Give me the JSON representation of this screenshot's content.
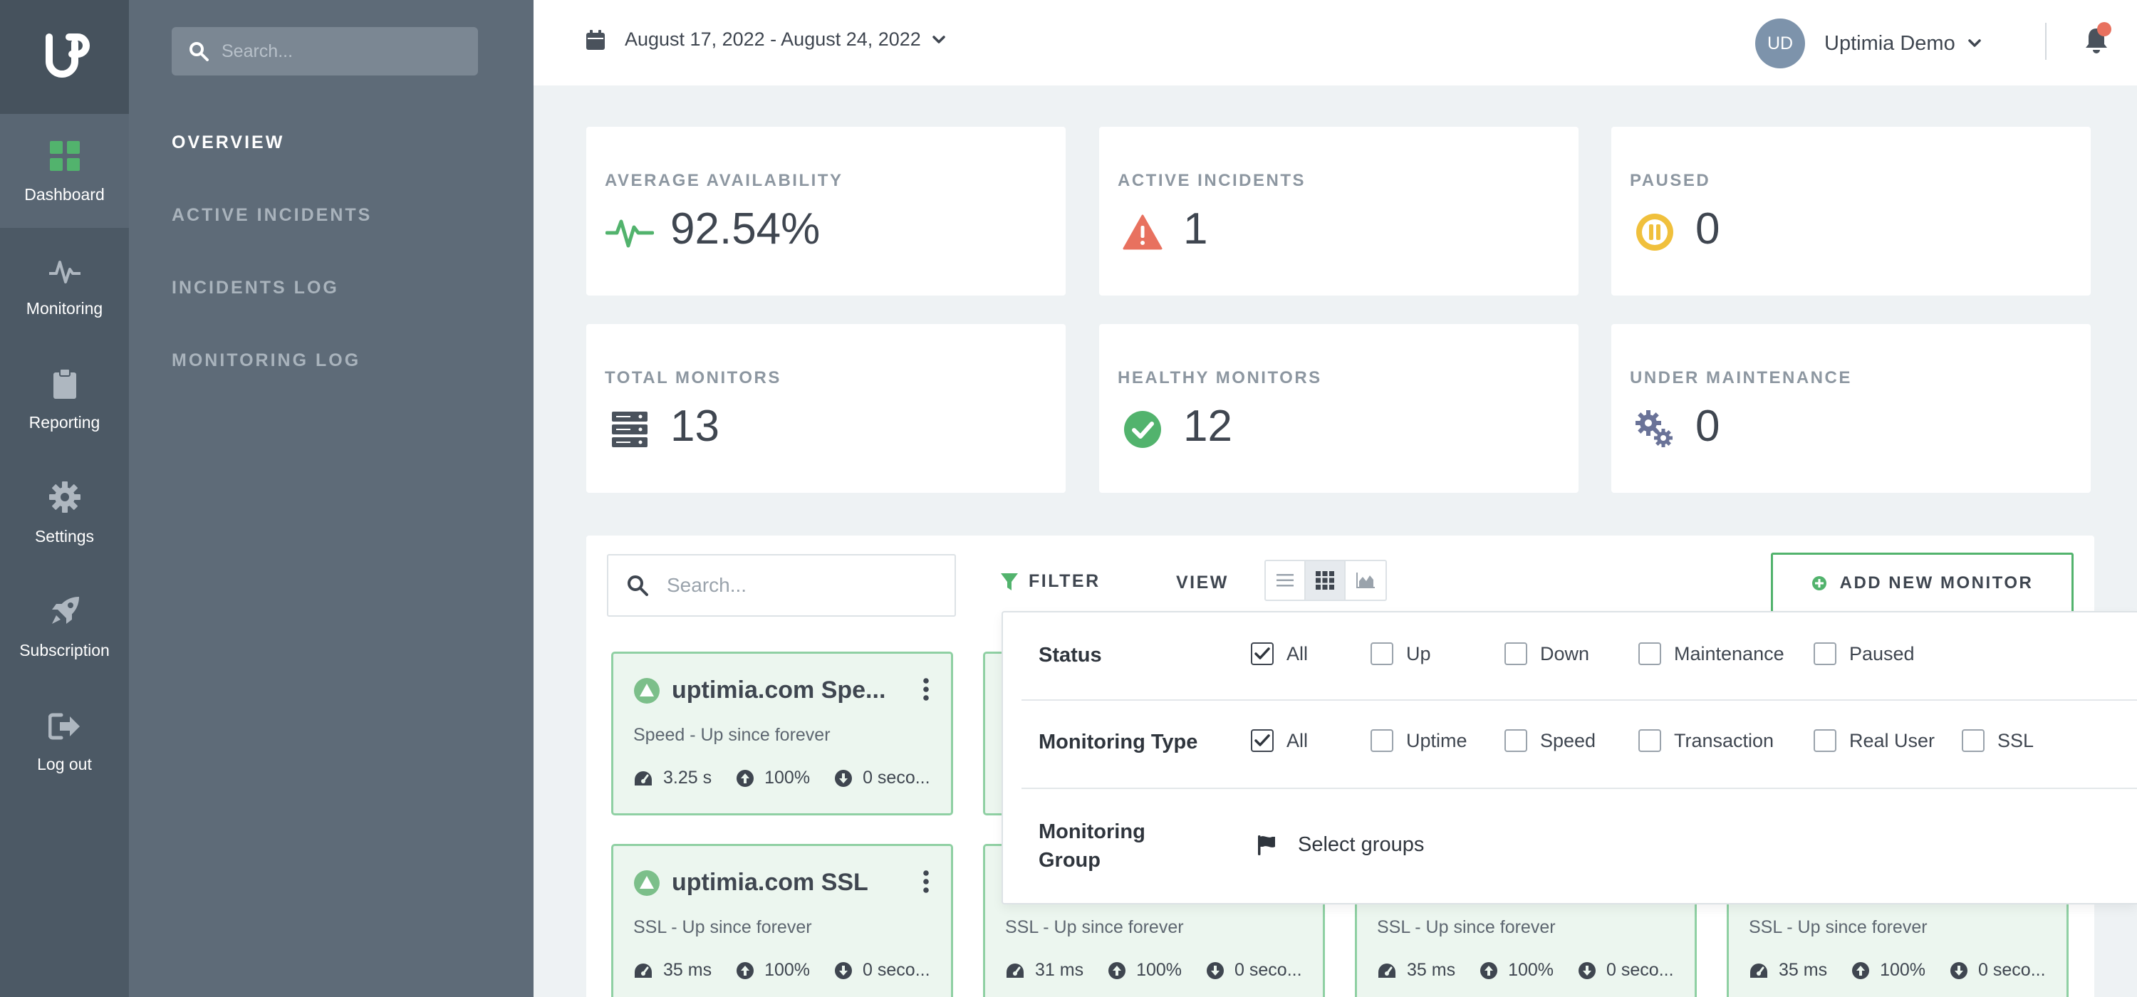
{
  "app": {
    "rail": [
      {
        "label": "Dashboard",
        "icon": "dashboard-grid-icon",
        "active": true
      },
      {
        "label": "Monitoring",
        "icon": "pulse-icon"
      },
      {
        "label": "Reporting",
        "icon": "clipboard-icon"
      },
      {
        "label": "Settings",
        "icon": "gear-icon"
      },
      {
        "label": "Subscription",
        "icon": "rocket-icon"
      },
      {
        "label": "Log out",
        "icon": "sign-out-icon"
      }
    ],
    "subnav": {
      "search_placeholder": "Search...",
      "links": [
        "OVERVIEW",
        "ACTIVE INCIDENTS",
        "INCIDENTS LOG",
        "MONITORING LOG"
      ]
    }
  },
  "header": {
    "date_range": "August 17, 2022 - August 24, 2022",
    "avatar_initials": "UD",
    "user_name": "Uptimia Demo"
  },
  "stats": [
    {
      "label": "AVERAGE AVAILABILITY",
      "value": "92.54%"
    },
    {
      "label": "ACTIVE INCIDENTS",
      "value": "1"
    },
    {
      "label": "PAUSED",
      "value": "0"
    },
    {
      "label": "TOTAL MONITORS",
      "value": "13"
    },
    {
      "label": "HEALTHY MONITORS",
      "value": "12"
    },
    {
      "label": "UNDER MAINTENANCE",
      "value": "0"
    }
  ],
  "toolbar": {
    "search_placeholder": "Search...",
    "filter_label": "FILTER",
    "view_label": "VIEW",
    "add_label": "ADD NEW MONITOR"
  },
  "monitors": [
    {
      "name": "uptimia.com Spe...",
      "status": "Speed - Up since forever",
      "response": "3.25 s",
      "uptime": "100%",
      "downtime": "0 seco..."
    },
    {
      "name": "uptimia.com SSL",
      "status": "SSL - Up since forever",
      "response": "35 ms",
      "uptime": "100%",
      "downtime": "0 seco..."
    },
    {
      "name": "",
      "status": "SSL - Up since forever",
      "response": "31 ms",
      "uptime": "100%",
      "downtime": "0 seco..."
    },
    {
      "name": "",
      "status": "SSL - Up since forever",
      "response": "35 ms",
      "uptime": "100%",
      "downtime": "0 seco..."
    },
    {
      "name": "",
      "status": "SSL - Up since forever",
      "response": "35 ms",
      "uptime": "100%",
      "downtime": "0 seco..."
    }
  ],
  "filter": {
    "status": {
      "label": "Status",
      "options": [
        {
          "label": "All",
          "checked": true
        },
        {
          "label": "Up",
          "checked": false
        },
        {
          "label": "Down",
          "checked": false
        },
        {
          "label": "Maintenance",
          "checked": false
        },
        {
          "label": "Paused",
          "checked": false
        }
      ]
    },
    "type": {
      "label": "Monitoring Type",
      "options": [
        {
          "label": "All",
          "checked": true
        },
        {
          "label": "Uptime",
          "checked": false
        },
        {
          "label": "Speed",
          "checked": false
        },
        {
          "label": "Transaction",
          "checked": false
        },
        {
          "label": "Real User",
          "checked": false
        },
        {
          "label": "SSL",
          "checked": false
        }
      ]
    },
    "group": {
      "label_line1": "Monitoring",
      "label_line2": "Group",
      "select_label": "Select groups"
    }
  },
  "colors": {
    "brand_green": "#52b36d",
    "alert_red": "#e8715f",
    "paused_yellow": "#f0c03c",
    "sidebar_dark": "#4c5965",
    "sidebar_mid": "#5e6b78"
  }
}
